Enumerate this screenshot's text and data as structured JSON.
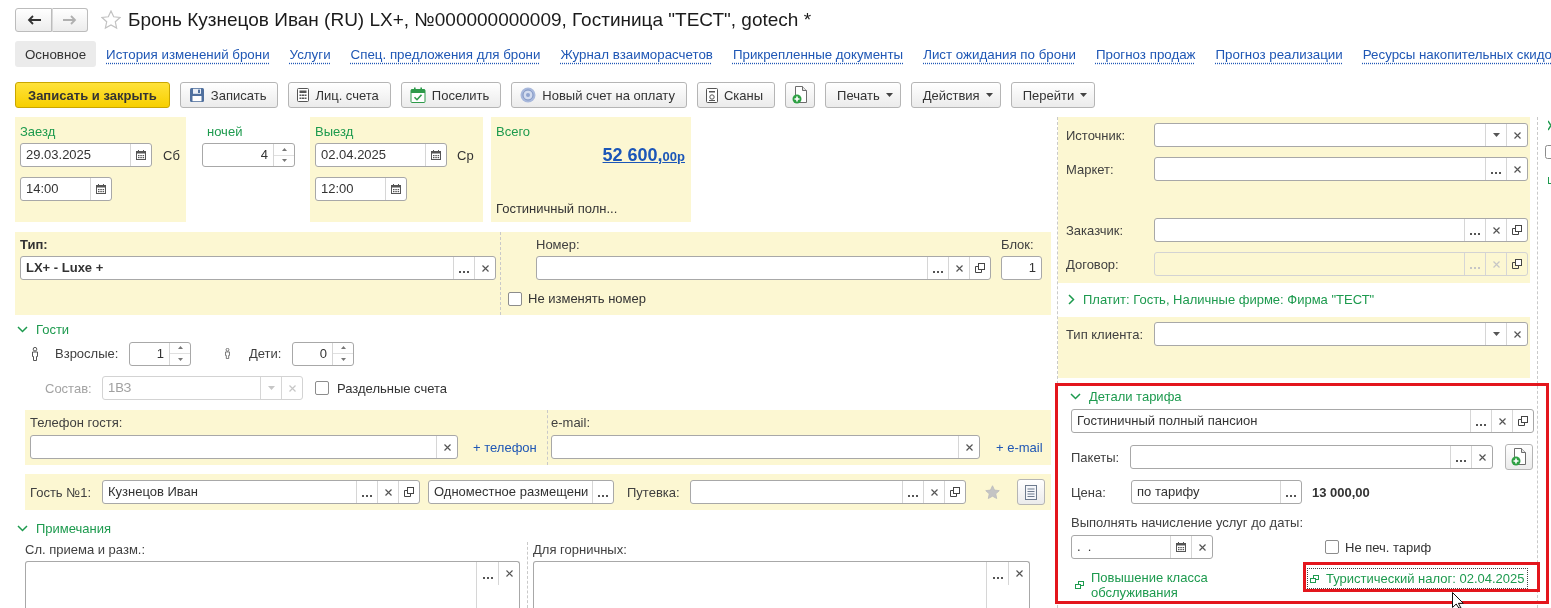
{
  "window": {
    "title": "Бронь Кузнецов Иван (RU) LX+, №000000000009, Гостиница \"ТЕСТ\", gotech *",
    "favorite": false,
    "back_disabled": false,
    "forward_disabled": true
  },
  "nav": [
    {
      "label": "Основное",
      "selected": true
    },
    {
      "label": "История изменений брони",
      "selected": false
    },
    {
      "label": "Услуги",
      "selected": false
    },
    {
      "label": "Спец. предложения для брони",
      "selected": false
    },
    {
      "label": "Журнал взаиморасчетов",
      "selected": false
    },
    {
      "label": "Прикрепленные документы",
      "selected": false
    },
    {
      "label": "Лист ожидания по брони",
      "selected": false
    },
    {
      "label": "Прогноз продаж",
      "selected": false
    },
    {
      "label": "Прогноз реализации",
      "selected": false
    },
    {
      "label": "Ресурсы накопительных скидо",
      "selected": false
    }
  ],
  "toolbar": [
    {
      "kind": "primary",
      "label": "Записать и закрыть"
    },
    {
      "kind": "icon_text",
      "label": "Записать"
    },
    {
      "kind": "icon_text",
      "label": "Лиц. счета"
    },
    {
      "kind": "icon_text",
      "label": "Поселить"
    },
    {
      "kind": "icon_text",
      "label": "Новый счет на оплату"
    },
    {
      "kind": "icon_text",
      "label": "Сканы"
    },
    {
      "kind": "icon"
    },
    {
      "kind": "menu",
      "label": "Печать"
    },
    {
      "kind": "menu",
      "label": "Действия"
    },
    {
      "kind": "menu",
      "label": "Перейти"
    }
  ],
  "stay": {
    "arrival": {
      "label": "Заезд",
      "date": "29.03.2025",
      "weekday": "Сб",
      "time": "14:00"
    },
    "nights": {
      "label": "ночей",
      "value": "4"
    },
    "departure": {
      "label": "Выезд",
      "date": "02.04.2025",
      "weekday": "Ср",
      "time": "12:00"
    },
    "total": {
      "label": "Всего",
      "amount": "52 600,",
      "fraction": "00р",
      "rate": "Гостиничный полн..."
    }
  },
  "room": {
    "type_label": "Тип:",
    "type": "LX+ - Luxe +",
    "number_label": "Номер:",
    "block_label": "Блок:",
    "block": "1",
    "keep_number": {
      "label": "Не изменять номер",
      "checked": false
    }
  },
  "guests": {
    "title": "Гости",
    "expanded": true,
    "adults_label": "Взрослые:",
    "adults": "1",
    "children_label": "Дети:",
    "children": "0",
    "composition_label": "Состав:",
    "composition": "1ВЗ",
    "composition_disabled": true,
    "separate_accounts": {
      "label": "Раздельные счета",
      "checked": false
    }
  },
  "contacts": {
    "phone_label": "Телефон гостя:",
    "add_phone": "+ телефон",
    "email_label": "e-mail:",
    "add_email": "+ e-mail"
  },
  "guest_row": {
    "label": "Гость №1:",
    "name": "Кузнецов Иван",
    "accommodation": "Одноместное размещени",
    "voucher_label": "Путевка:",
    "starred": false
  },
  "notes": {
    "title": "Примечания",
    "expanded": true,
    "fields": [
      {
        "label": "Сл. приема и разм.:"
      },
      {
        "label": "Для горничных:"
      }
    ]
  },
  "booking": {
    "source_fields": [
      {
        "label": "Источник:",
        "kind": "select",
        "disabled": false
      },
      {
        "label": "Маркет:",
        "kind": "choice",
        "disabled": false
      }
    ],
    "customer_fields": [
      {
        "label": "Заказчик:",
        "kind": "reference",
        "disabled": false
      },
      {
        "label": "Договор:",
        "kind": "reference",
        "disabled": true
      }
    ]
  },
  "payer": {
    "text": "Платит: Гость, Наличные фирме: Фирма \"ТЕСТ\"",
    "expanded": false
  },
  "client_type": {
    "label": "Тип клиента:",
    "kind": "select"
  },
  "tariff": {
    "title": "Детали тарифа",
    "expanded": true,
    "highlighted": true,
    "rate": "Гостиничный полный пансион",
    "packages_label": "Пакеты:",
    "price_label": "Цена:",
    "price_mode": "по тарифу",
    "price": "13 000,00",
    "charge_until_label": "Выполнять начисление услуг до даты:",
    "charge_until": ".  .",
    "no_print": {
      "label": "Не печ. тариф",
      "checked": false
    },
    "links": [
      {
        "label": "Повышение класса обслуживания",
        "highlighted": false,
        "focused": false
      },
      {
        "label": "Туристический налог: 02.04.2025",
        "highlighted": true,
        "focused": true
      }
    ]
  }
}
